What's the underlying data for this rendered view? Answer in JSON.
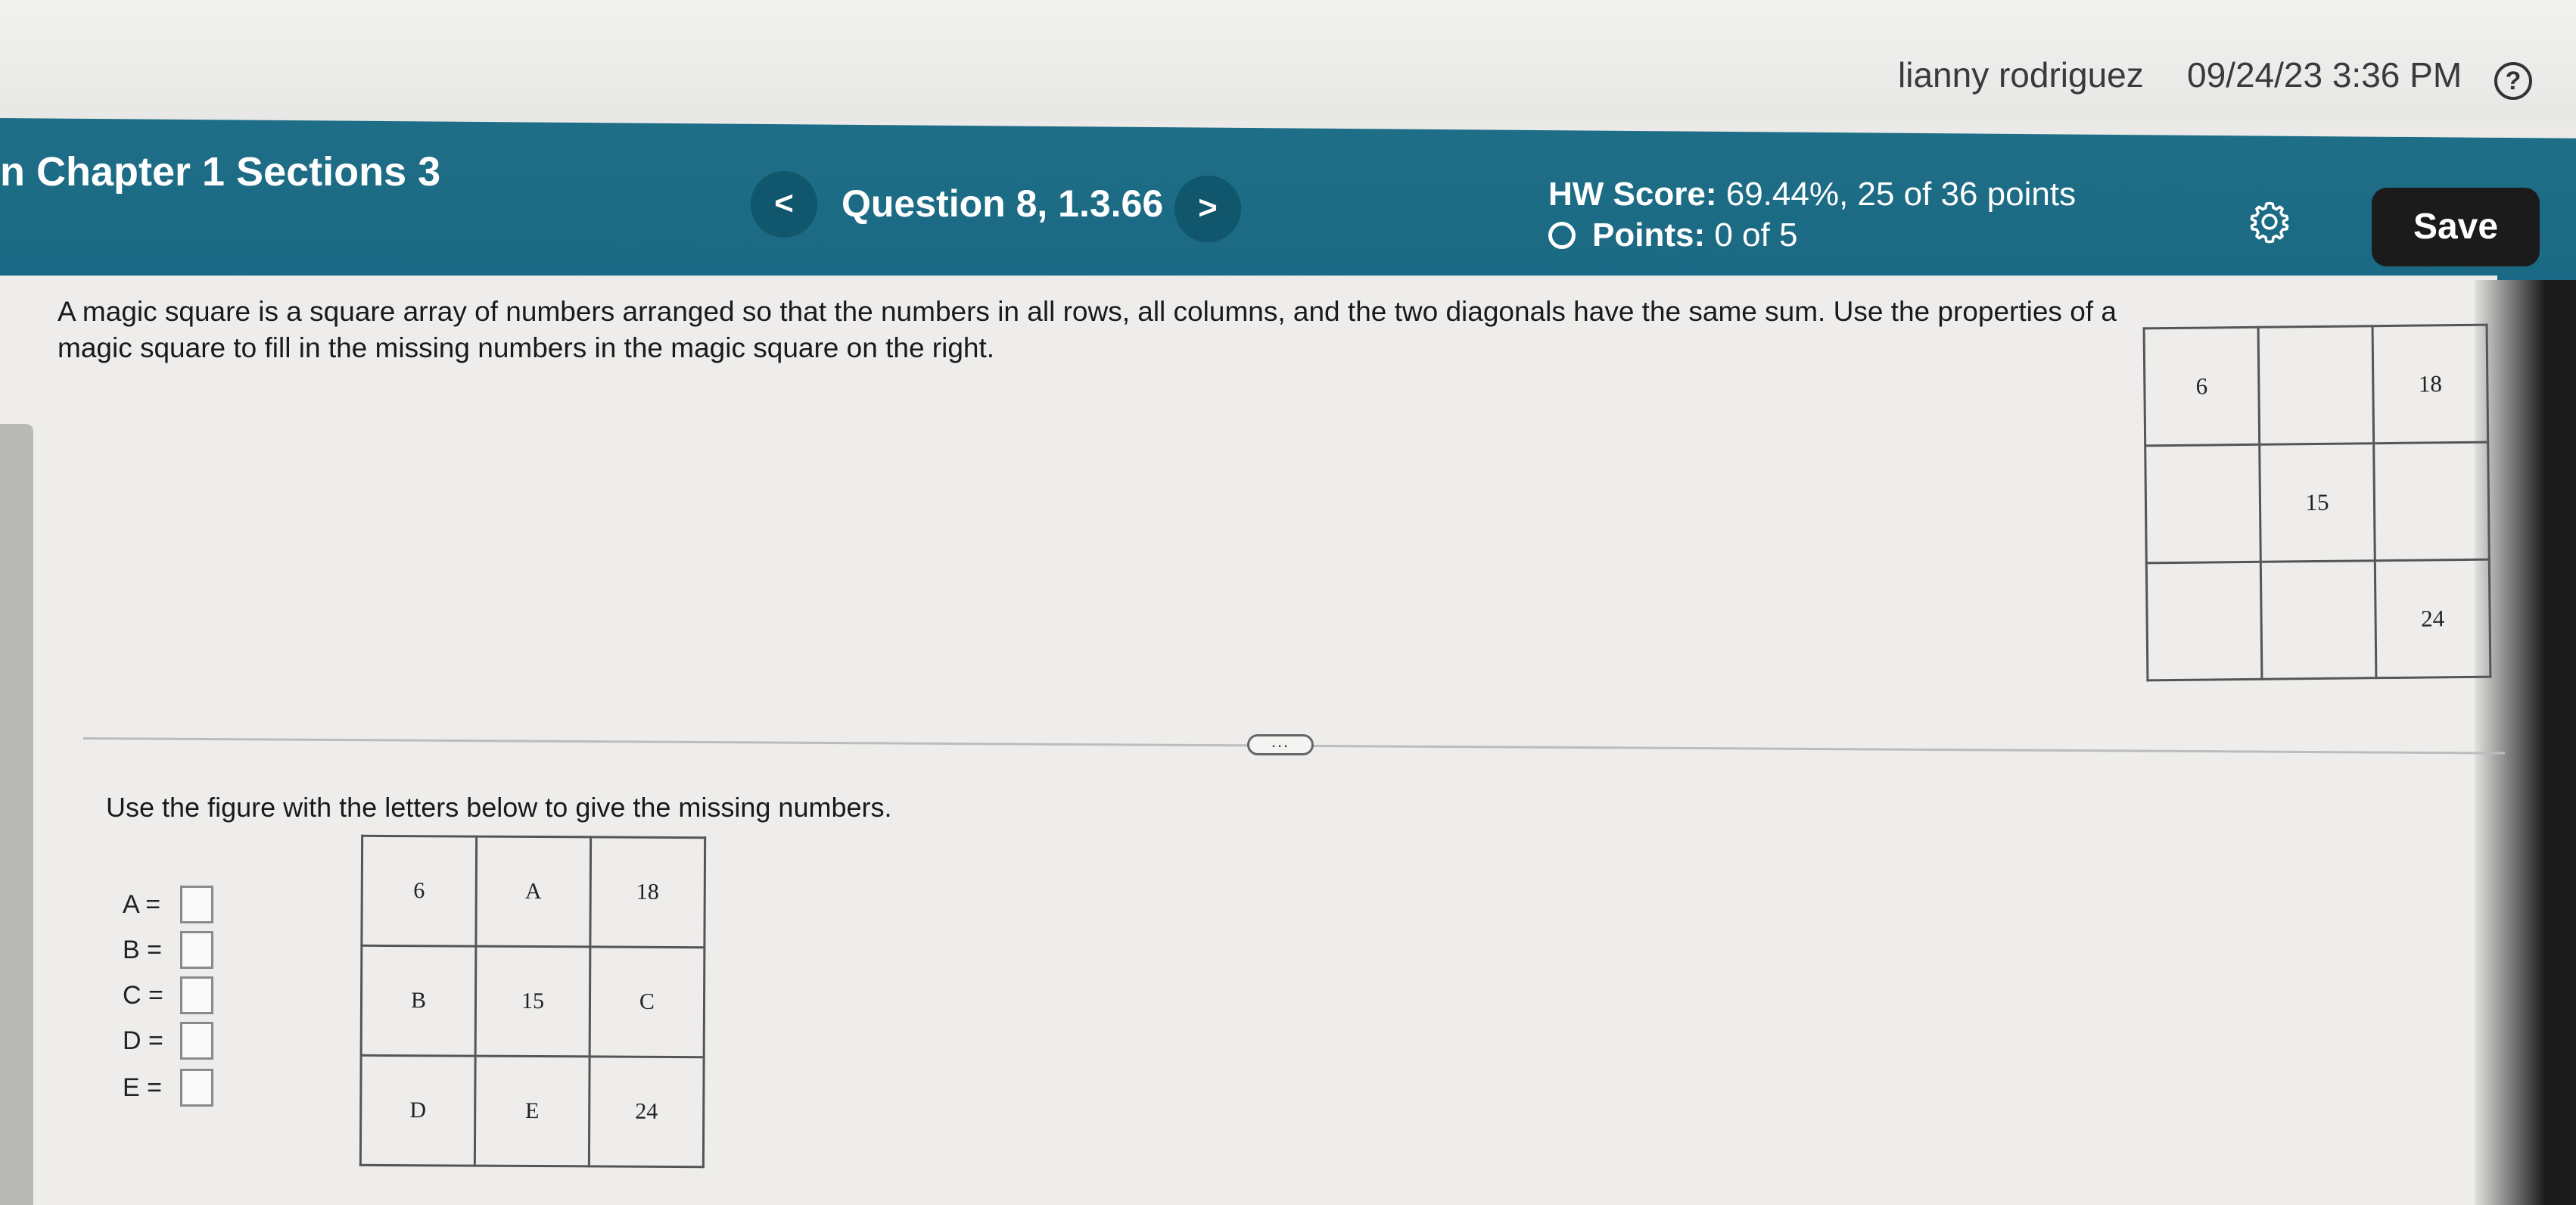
{
  "user": {
    "name": "lianny rodriguez",
    "datetime": "09/24/23 3:36 PM",
    "help_icon": "?"
  },
  "header": {
    "course_title": "n Chapter 1 Sections 3",
    "prev_icon": "<",
    "next_icon": ">",
    "question_label": "Question 8, 1.3.66",
    "hw_score_label": "HW Score:",
    "hw_score_value": "69.44%, 25 of 36 points",
    "points_label": "Points:",
    "points_value": "0 of 5",
    "save_label": "Save"
  },
  "question": {
    "text": "A magic square is a square array of numbers arranged so that the numbers in all rows, all columns, and the two diagonals have the same sum.  Use the properties of a magic square to fill in the missing numbers in the magic square on the right.",
    "top_grid": [
      [
        "6",
        "",
        "18"
      ],
      [
        "",
        "15",
        ""
      ],
      [
        "",
        "",
        "24"
      ]
    ],
    "more_label": "...",
    "instruction": "Use the figure with the letters below to give the missing numbers.",
    "bottom_grid": [
      [
        "6",
        "A",
        "18"
      ],
      [
        "B",
        "15",
        "C"
      ],
      [
        "D",
        "E",
        "24"
      ]
    ],
    "answers": [
      {
        "label": "A =",
        "value": ""
      },
      {
        "label": "B =",
        "value": ""
      },
      {
        "label": "C =",
        "value": ""
      },
      {
        "label": "D =",
        "value": ""
      },
      {
        "label": "E =",
        "value": ""
      }
    ]
  }
}
